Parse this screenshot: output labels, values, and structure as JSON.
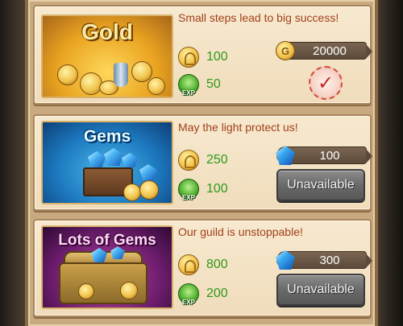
{
  "offers": [
    {
      "art_title": "Gold",
      "slogan": "Small steps lead to big success!",
      "rewards": [
        {
          "icon": "coin-reward-icon",
          "value": "100"
        },
        {
          "icon": "exp-icon",
          "value": "50",
          "icon_text": "EXP"
        }
      ],
      "price": {
        "currency_icon": "gold-coin-icon",
        "currency_symbol": "G",
        "value": "20000"
      },
      "status": "purchased",
      "status_icon": "check-icon"
    },
    {
      "art_title": "Gems",
      "slogan": "May the light protect us!",
      "rewards": [
        {
          "icon": "coin-reward-icon",
          "value": "250"
        },
        {
          "icon": "exp-icon",
          "value": "100",
          "icon_text": "EXP"
        }
      ],
      "price": {
        "currency_icon": "gem-icon",
        "value": "100"
      },
      "button_label": "Unavailable"
    },
    {
      "art_title": "Lots of Gems",
      "slogan": "Our guild is unstoppable!",
      "rewards": [
        {
          "icon": "coin-reward-icon",
          "value": "800"
        },
        {
          "icon": "exp-icon",
          "value": "200",
          "icon_text": "EXP"
        }
      ],
      "price": {
        "currency_icon": "gem-icon",
        "value": "300"
      },
      "button_label": "Unavailable"
    }
  ],
  "colors": {
    "slogan": "#a0401a",
    "reward_value": "#2f9a1c",
    "card_bg": "#f7e9cf",
    "frame": "#c9aa80",
    "button_disabled": "#6a6a6a",
    "check": "#c62828"
  }
}
